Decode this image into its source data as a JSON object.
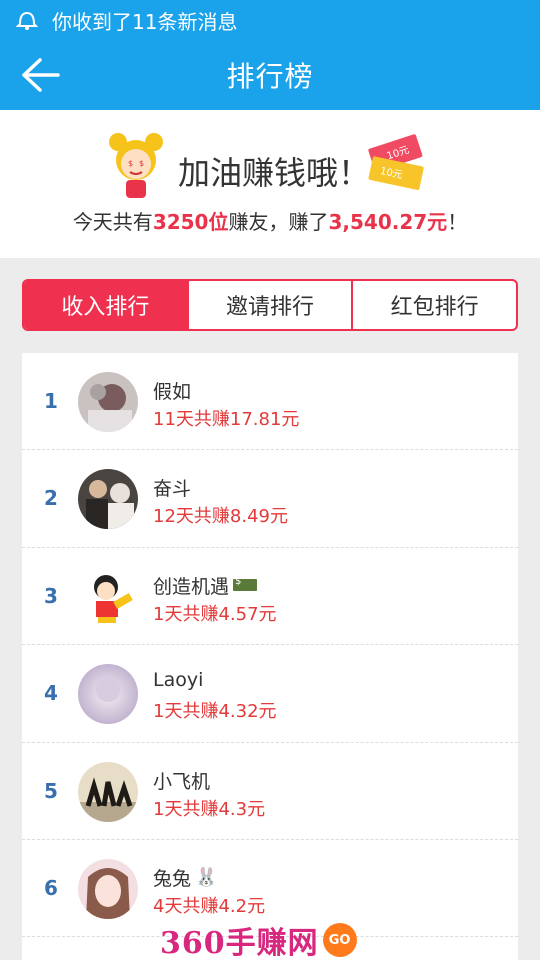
{
  "status_bar": {
    "message": "你收到了11条新消息",
    "icon": "notification-bell-icon"
  },
  "app_bar": {
    "title": "排行榜",
    "back_icon": "back-arrow-icon"
  },
  "banner": {
    "headline": "加油赚钱哦！",
    "summary_prefix": "今天共有",
    "users_count": "3250位",
    "summary_middle": "赚友，赚了",
    "total_amount": "3,540.27元",
    "summary_suffix": "！",
    "money_note_1": "10元",
    "money_note_2": "10元"
  },
  "tabs": [
    {
      "label": "收入排行",
      "active": true
    },
    {
      "label": "邀请排行",
      "active": false
    },
    {
      "label": "红包排行",
      "active": false
    }
  ],
  "rankings": [
    {
      "rank": "1",
      "name": "假如",
      "earnings": "11天共赚17.81元"
    },
    {
      "rank": "2",
      "name": "奋斗",
      "earnings": "12天共赚8.49元"
    },
    {
      "rank": "3",
      "name": "创造机遇",
      "earnings": "1天共赚4.57元",
      "badge": "money-badge-icon"
    },
    {
      "rank": "4",
      "name": "Laoyi",
      "earnings": "1天共赚4.32元"
    },
    {
      "rank": "5",
      "name": "小飞机",
      "earnings": "1天共赚4.3元"
    },
    {
      "rank": "6",
      "name": "兔兔",
      "earnings": "4天共赚4.2元",
      "badge": "bunny-icon"
    }
  ],
  "watermark": {
    "text": "360手赚网",
    "go_label": "GO"
  },
  "colors": {
    "primary_blue": "#1aa3ea",
    "accent_red": "#f0304f",
    "earn_red": "#e33a3a",
    "rank_blue": "#3a6fae"
  }
}
